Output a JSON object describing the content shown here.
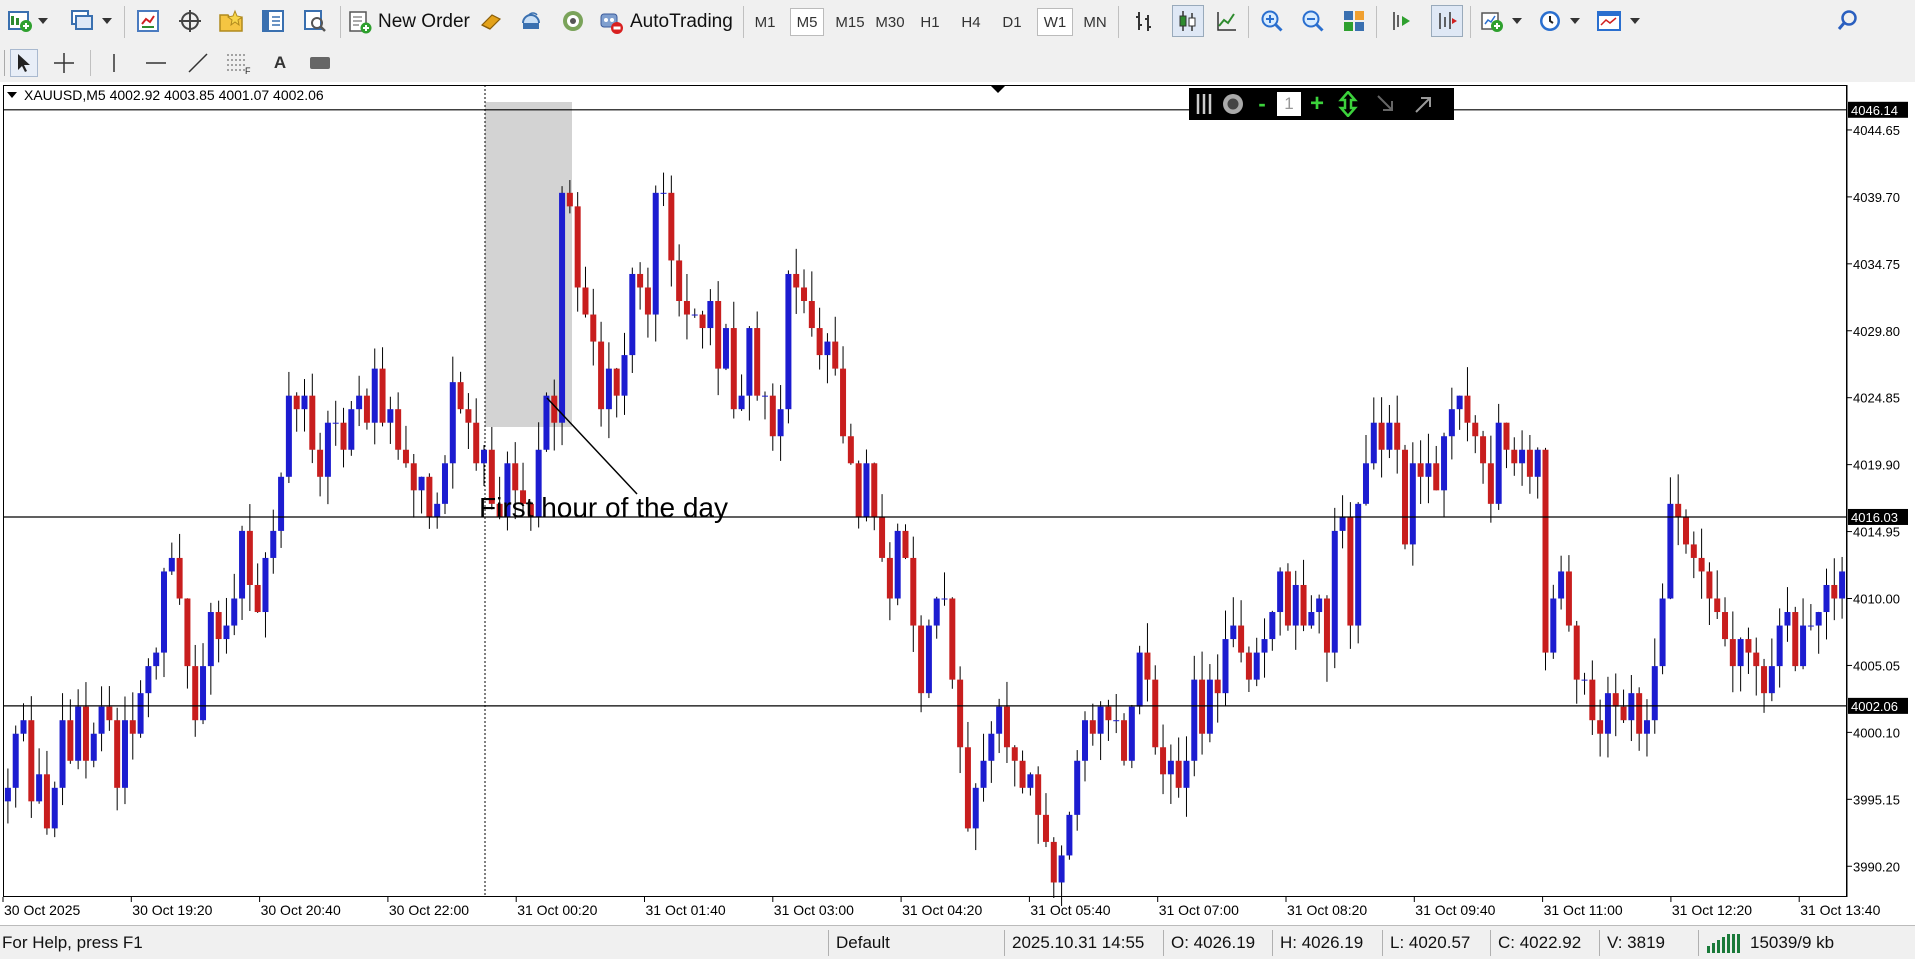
{
  "toolbar": {
    "new_order_label": "New Order",
    "autotrading_label": "AutoTrading",
    "timeframes": [
      "M1",
      "M5",
      "M15",
      "M30",
      "H1",
      "H4",
      "D1",
      "W1",
      "MN"
    ],
    "active_timeframe": "M5",
    "highlighted_timeframe": "W1"
  },
  "drawing_tools": {
    "text_tool_label": "A"
  },
  "one_click": {
    "minus_label": "-",
    "lot_value": "1",
    "plus_label": "+"
  },
  "chart": {
    "symbol_info": "XAUUSD,M5  4002.92 4003.85 4001.07 4002.06",
    "annotation": "First hour of the day",
    "y_ticks": [
      "4044.65",
      "4039.70",
      "4034.75",
      "4029.80",
      "4024.85",
      "4019.90",
      "4014.95",
      "4010.00",
      "4005.05",
      "4000.10",
      "3995.15",
      "3990.20"
    ],
    "x_labels": [
      "30 Oct 2025",
      "30 Oct 19:20",
      "30 Oct 20:40",
      "30 Oct 22:00",
      "31 Oct 00:20",
      "31 Oct 01:40",
      "31 Oct 03:00",
      "31 Oct 04:20",
      "31 Oct 05:40",
      "31 Oct 07:00",
      "31 Oct 08:20",
      "31 Oct 09:40",
      "31 Oct 11:00",
      "31 Oct 12:20",
      "31 Oct 13:40"
    ],
    "horizontal_lines": [
      {
        "value": 4046.14,
        "label": "4046.14"
      },
      {
        "value": 4016.03,
        "label": "4016.03"
      },
      {
        "value": 4002.06,
        "label": "4002.06"
      }
    ],
    "colors": {
      "bull": "#1c1cd0",
      "bear": "#c81e1e",
      "highlight": "#d3d3d3"
    }
  },
  "chart_data": {
    "type": "candlestick",
    "symbol": "XAUUSD",
    "timeframe": "M5",
    "ylim": [
      3988.0,
      4047.9
    ],
    "closes": [
      3996,
      4000,
      4001,
      3995,
      3997,
      3993,
      3996,
      4001,
      3998,
      4002,
      3998,
      4000,
      4002,
      4001,
      3996,
      4001,
      4000,
      4003,
      4005,
      4006,
      4012,
      4013,
      4010,
      4005,
      4001,
      4005,
      4009,
      4007,
      4008,
      4010,
      4015,
      4011,
      4009,
      4013,
      4015,
      4019,
      4025,
      4024,
      4025,
      4021,
      4019,
      4023,
      4023,
      4021,
      4024,
      4025,
      4023,
      4027,
      4023,
      4024,
      4021,
      4020,
      4018,
      4019,
      4016,
      4017,
      4020,
      4026,
      4024,
      4023,
      4020,
      4021,
      4017,
      4016,
      4020,
      4018,
      4017,
      4016,
      4021,
      4025,
      4023,
      4040,
      4039,
      4033,
      4031,
      4029,
      4024,
      4027,
      4025,
      4028,
      4034,
      4033,
      4031,
      4040,
      4040,
      4035,
      4032,
      4031,
      4031,
      4030,
      4032,
      4027,
      4030,
      4024,
      4025,
      4030,
      4025,
      4025,
      4022,
      4024,
      4034,
      4033,
      4032,
      4030,
      4028,
      4029,
      4027,
      4022,
      4020,
      4016,
      4020,
      4016,
      4013,
      4010,
      4015,
      4013,
      4008,
      4003,
      4008,
      4010,
      4010,
      4004,
      3999,
      3993,
      3996,
      3998,
      4000,
      4002,
      3999,
      3998,
      3996,
      3997,
      3994,
      3992,
      3989,
      3991,
      3994,
      3998,
      4001,
      4000,
      4002,
      4001,
      4001,
      3998,
      4002,
      4006,
      4004,
      3999,
      3997,
      3998,
      3996,
      3998,
      4004,
      4000,
      4004,
      4003,
      4007,
      4008,
      4006,
      4004,
      4006,
      4007,
      4009,
      4012,
      4008,
      4011,
      4008,
      4009,
      4010,
      4006,
      4015,
      4016,
      4008,
      4017,
      4020,
      4023,
      4021,
      4023,
      4021,
      4014,
      4020,
      4019,
      4020,
      4018,
      4022,
      4024,
      4025,
      4023,
      4022,
      4020,
      4017,
      4023,
      4021,
      4020,
      4021,
      4019,
      4021,
      4006,
      4010,
      4012,
      4008,
      4004,
      4004,
      4001,
      4000,
      4003,
      4002,
      4001,
      4003,
      4000,
      4001,
      4005,
      4010,
      4017,
      4016,
      4014,
      4013,
      4012,
      4010,
      4009,
      4007,
      4005,
      4007,
      4006,
      4005,
      4003,
      4005,
      4008,
      4009,
      4005,
      4008,
      4008,
      4009,
      4011,
      4010,
      4012
    ]
  }
}
